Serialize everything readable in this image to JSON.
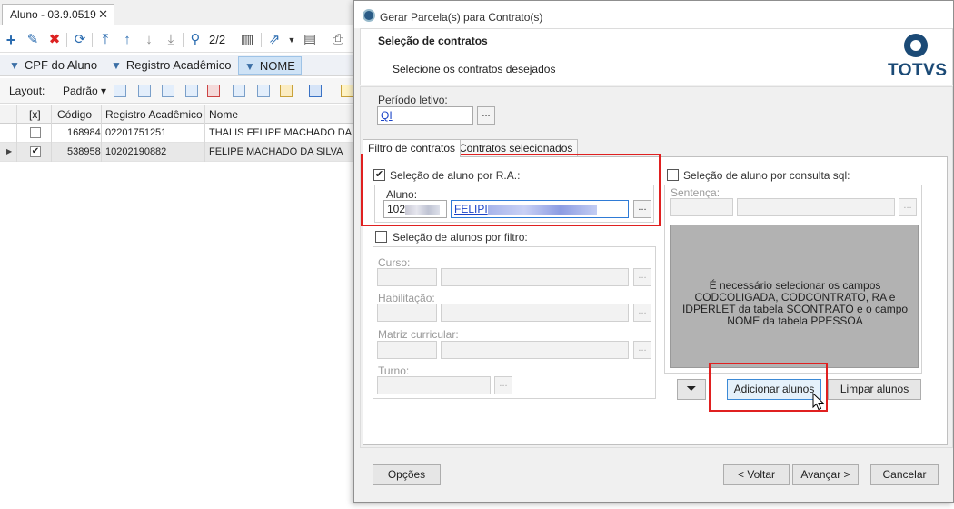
{
  "background": {
    "doc_tab": {
      "title": "Aluno - 03.9.0519",
      "close": "✕"
    },
    "pager": "2/2",
    "filters": [
      {
        "label": "CPF do Aluno"
      },
      {
        "label": "Registro Acadêmico"
      },
      {
        "label": "NOME",
        "active": true
      }
    ],
    "layout": {
      "label": "Layout:",
      "value": "Padrão ▾"
    },
    "grid": {
      "columns": [
        "[x]",
        "Código",
        "Registro Acadêmico",
        "Nome"
      ],
      "rows": [
        {
          "checked": false,
          "codigo": "168984",
          "registro": "02201751251",
          "nome": "THALIS  FELIPE MACHADO DA SI"
        },
        {
          "checked": true,
          "codigo": "538958",
          "registro": "10202190882",
          "nome": "FELIPE MACHADO DA SILVA"
        }
      ]
    }
  },
  "dialog": {
    "title": "Gerar Parcela(s) para Contrato(s)",
    "header": {
      "title": "Seleção de contratos",
      "subtitle": "Selecione os contratos desejados",
      "logo_text": "TOTVS"
    },
    "periodo": {
      "label": "Período letivo:",
      "value": "QI"
    },
    "tabs": [
      {
        "label": "Filtro de contratos",
        "active": true
      },
      {
        "label": "Contratos selecionados",
        "active": false
      }
    ],
    "ra_section": {
      "checkbox_label": "Seleção de aluno por R.A.:",
      "checked": true,
      "aluno_label": "Aluno:",
      "ra_value": "102",
      "nome_value": "FELIPI"
    },
    "filtro_section": {
      "checkbox_label": "Seleção de alunos por filtro:",
      "checked": false,
      "curso_label": "Curso:",
      "habilitacao_label": "Habilitação:",
      "matriz_label": "Matriz curricular:",
      "turno_label": "Turno:"
    },
    "sql_section": {
      "checkbox_label": "Seleção de aluno por consulta sql:",
      "checked": false,
      "sentenca_label": "Sentença:",
      "message": "É necessário selecionar os campos CODCOLIGADA, CODCONTRATO, RA e IDPERLET da tabela SCONTRATO e o campo NOME da tabela PPESSOA"
    },
    "buttons": {
      "dots": "...",
      "adicionar": "Adicionar alunos",
      "limpar": "Limpar alunos",
      "opcoes": "Opções",
      "voltar": "< Voltar",
      "avancar": "Avançar >",
      "cancelar": "Cancelar"
    },
    "colors": {
      "highlight": "#e02020",
      "link": "#1a43c7",
      "brand": "#1b4a76"
    }
  }
}
